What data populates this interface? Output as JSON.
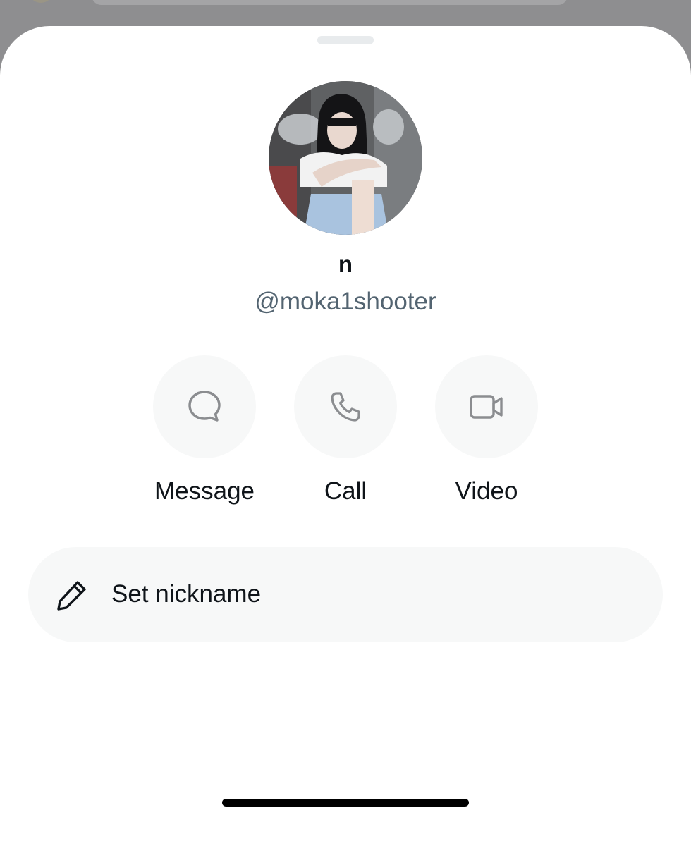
{
  "profile": {
    "display_name": "n",
    "handle": "@moka1shooter",
    "avatar": "avatar-photo"
  },
  "actions": [
    {
      "label": "Message",
      "icon": "message-bubble-icon"
    },
    {
      "label": "Call",
      "icon": "phone-icon"
    },
    {
      "label": "Video",
      "icon": "video-camera-icon"
    }
  ],
  "nickname": {
    "label": "Set nickname",
    "icon": "pencil-icon"
  },
  "colors": {
    "text_primary": "#0f1419",
    "text_secondary": "#536471",
    "surface": "#f7f8f8",
    "icon": "#8b8d90"
  }
}
